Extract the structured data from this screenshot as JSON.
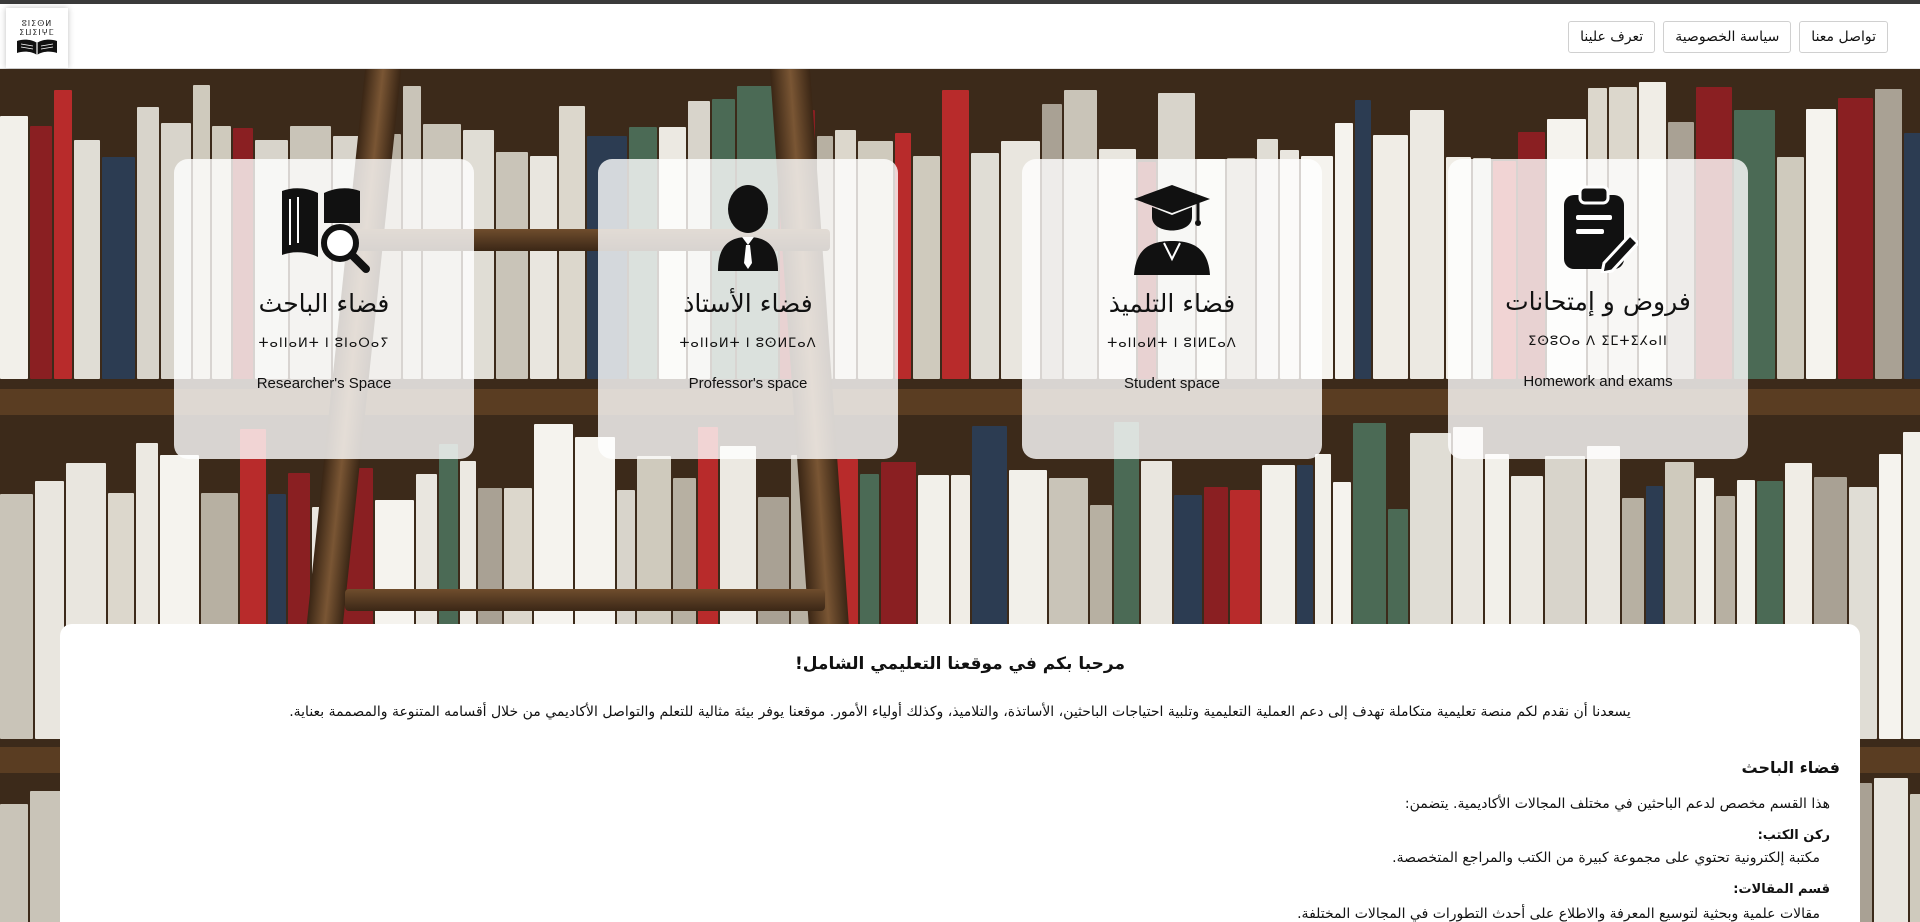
{
  "logo": {
    "line1": "ⵓⵏⵉⵙⵍ",
    "line2": "ⵉⵡⵉⵏⵖⵎ"
  },
  "nav": {
    "items": [
      "تواصل معنا",
      "سياسة الخصوصية",
      "تعرف علينا"
    ]
  },
  "cards": [
    {
      "title_ar": "فروض و إمتحانات",
      "title_tz": "ⵉⵙⵓⵔⴰ ⴷ ⵉⵎⵜⵉⵃⴰⵏⵏ",
      "title_en": "Homework and exams",
      "icon": "clipboard-edit-icon"
    },
    {
      "title_ar": "فضاء التلميذ",
      "title_tz": "ⵜⴰⵏⵏⴰⵍⵜ ⵏ ⵓⵏⵍⵎⴰⴷ",
      "title_en": "Student space",
      "icon": "graduate-icon"
    },
    {
      "title_ar": "فضاء الأستاذ",
      "title_tz": "ⵜⴰⵏⵏⴰⵍⵜ ⵏ ⵓⵙⵍⵎⴰⴷ",
      "title_en": "Professor's space",
      "icon": "professor-icon"
    },
    {
      "title_ar": "فضاء الباحث",
      "title_tz": "ⵜⴰⵏⵏⴰⵍⵜ ⵏ ⵓⵏⴰⵔⴰⵢ",
      "title_en": "Researcher's Space",
      "icon": "book-search-icon"
    }
  ],
  "content": {
    "welcome_title": "مرحبا بكم في موقعنا التعليمي الشامل!",
    "intro": "يسعدنا أن نقدم لكم منصة تعليمية متكاملة تهدف إلى دعم العملية التعليمية وتلبية احتياجات الباحثين، الأساتذة، والتلاميذ، وكذلك أولياء الأمور. موقعنا يوفر بيئة مثالية للتعلم والتواصل الأكاديمي من خلال أقسامه المتنوعة والمصممة بعناية.",
    "section_title": "فضاء الباحث",
    "section_desc": "هذا القسم مخصص لدعم الباحثين في مختلف المجالات الأكاديمية. يتضمن:",
    "sub1_title": "ركن الكتب:",
    "sub1_desc": "مكتبة إلكترونية تحتوي على مجموعة كبيرة من الكتب والمراجع المتخصصة.",
    "sub2_title": "قسم المقالات:",
    "sub2_desc": "مقالات علمية وبحثية لتوسيع المعرفة والاطلاع على أحدث التطورات في المجالات المختلفة."
  }
}
